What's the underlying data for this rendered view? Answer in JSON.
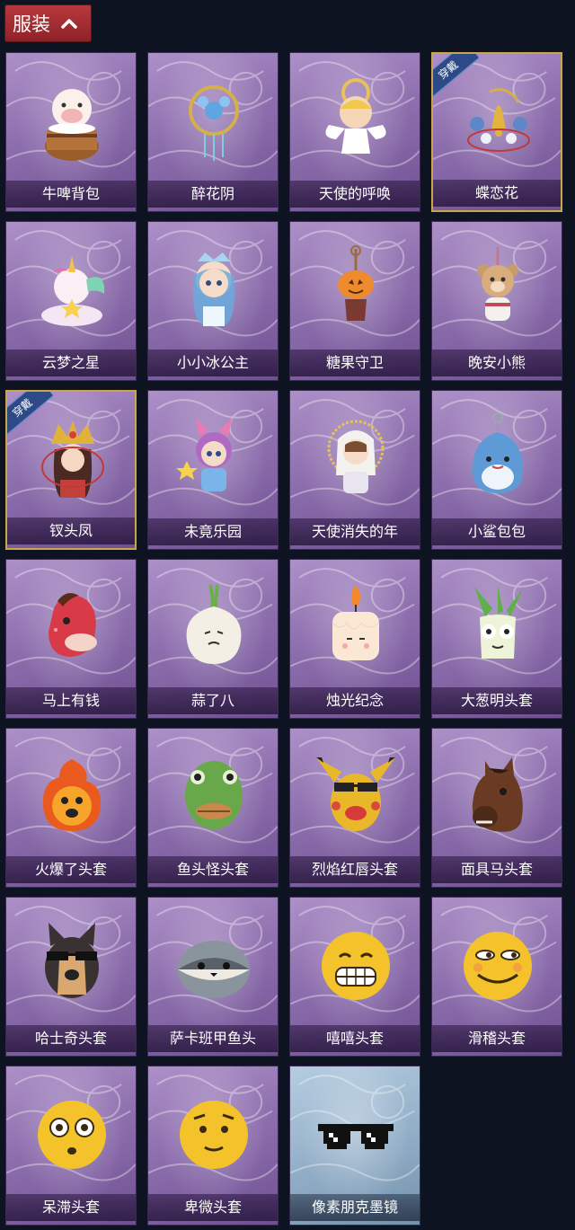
{
  "header": {
    "title": "服装"
  },
  "badge_text": "穿戴",
  "items": [
    {
      "name": "牛啤背包",
      "icon": "cow-beer-barrel-icon",
      "wearing": false,
      "tone": "purple"
    },
    {
      "name": "醉花阴",
      "icon": "flower-dreamcatcher-icon",
      "wearing": false,
      "tone": "purple"
    },
    {
      "name": "天使的呼唤",
      "icon": "angel-doll-icon",
      "wearing": false,
      "tone": "purple"
    },
    {
      "name": "蝶恋花",
      "icon": "butterfly-bell-icon",
      "wearing": true,
      "tone": "purple"
    },
    {
      "name": "云梦之星",
      "icon": "unicorn-cloud-icon",
      "wearing": false,
      "tone": "purple"
    },
    {
      "name": "小小冰公主",
      "icon": "ice-princess-icon",
      "wearing": false,
      "tone": "purple"
    },
    {
      "name": "糖果守卫",
      "icon": "pumpkin-pendant-icon",
      "wearing": false,
      "tone": "purple"
    },
    {
      "name": "晚安小熊",
      "icon": "bear-pendant-icon",
      "wearing": false,
      "tone": "purple"
    },
    {
      "name": "钗头凤",
      "icon": "phoenix-crown-icon",
      "wearing": true,
      "tone": "purple"
    },
    {
      "name": "未竟乐园",
      "icon": "jester-girl-icon",
      "wearing": false,
      "tone": "purple"
    },
    {
      "name": "天使消失的年",
      "icon": "halo-angel-icon",
      "wearing": false,
      "tone": "purple"
    },
    {
      "name": "小鲨包包",
      "icon": "shark-bag-icon",
      "wearing": false,
      "tone": "purple"
    },
    {
      "name": "马上有钱",
      "icon": "red-horse-head-icon",
      "wearing": false,
      "tone": "purple"
    },
    {
      "name": "蒜了八",
      "icon": "garlic-head-icon",
      "wearing": false,
      "tone": "purple"
    },
    {
      "name": "烛光纪念",
      "icon": "candle-head-icon",
      "wearing": false,
      "tone": "purple"
    },
    {
      "name": "大葱明头套",
      "icon": "scallion-head-icon",
      "wearing": false,
      "tone": "purple"
    },
    {
      "name": "火爆了头套",
      "icon": "fire-head-icon",
      "wearing": false,
      "tone": "purple"
    },
    {
      "name": "鱼头怪头套",
      "icon": "fish-mask-icon",
      "wearing": false,
      "tone": "purple"
    },
    {
      "name": "烈焰红唇头套",
      "icon": "yellow-mouse-mask-icon",
      "wearing": false,
      "tone": "purple"
    },
    {
      "name": "面具马头套",
      "icon": "horse-mask-icon",
      "wearing": false,
      "tone": "purple"
    },
    {
      "name": "哈士奇头套",
      "icon": "husky-mask-icon",
      "wearing": false,
      "tone": "purple"
    },
    {
      "name": "萨卡班甲鱼头",
      "icon": "sacabambaspis-head-icon",
      "wearing": false,
      "tone": "purple"
    },
    {
      "name": "嘻嘻头套",
      "icon": "grin-emoji-head-icon",
      "wearing": false,
      "tone": "purple"
    },
    {
      "name": "滑稽头套",
      "icon": "funny-emoji-head-icon",
      "wearing": false,
      "tone": "purple"
    },
    {
      "name": "呆滞头套",
      "icon": "dazed-emoji-head-icon",
      "wearing": false,
      "tone": "purple"
    },
    {
      "name": "卑微头套",
      "icon": "humble-emoji-head-icon",
      "wearing": false,
      "tone": "purple"
    },
    {
      "name": "像素朋克墨镜",
      "icon": "pixel-sunglasses-icon",
      "wearing": false,
      "tone": "blue"
    }
  ]
}
